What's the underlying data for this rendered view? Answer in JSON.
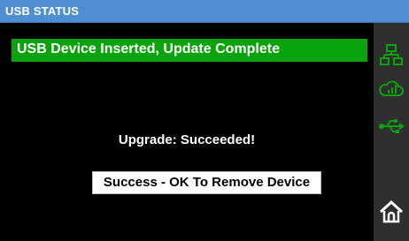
{
  "window": {
    "title": "USB STATUS"
  },
  "status_banner": {
    "text": "USB Device Inserted, Update Complete",
    "color": "#0ba30b"
  },
  "upgrade": {
    "text": "Upgrade: Succeeded!"
  },
  "remove_message": {
    "text": "Success - OK To Remove Device"
  },
  "sidebar": {
    "items": [
      {
        "icon": "network-icon"
      },
      {
        "icon": "cloud-signal-icon"
      },
      {
        "icon": "usb-icon"
      },
      {
        "icon": "home-icon"
      }
    ]
  },
  "colors": {
    "titlebar": "#4f8fd1",
    "accent_green": "#0ba30b",
    "sidebar": "#2f2f2f",
    "background": "#000000"
  }
}
